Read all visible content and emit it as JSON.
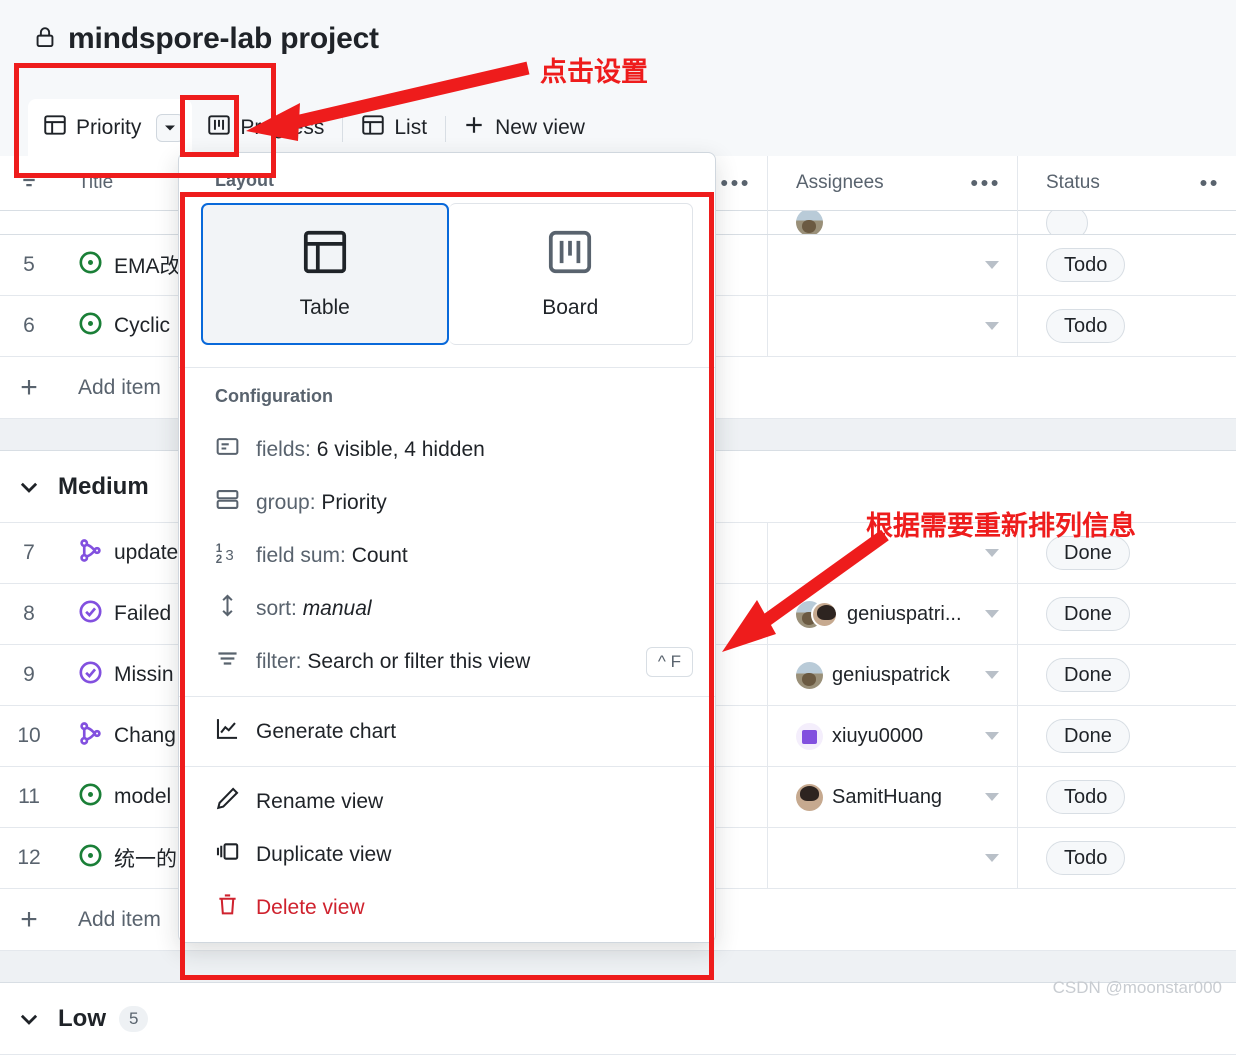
{
  "header": {
    "lock_icon": "lock-icon",
    "title": "mindspore-lab project"
  },
  "tabs": [
    {
      "label": "Priority",
      "icon": "table-view-icon",
      "active": true,
      "caret": "chevron-down-icon"
    },
    {
      "label": "Progress",
      "icon": "board-view-icon",
      "active": false
    },
    {
      "label": "List",
      "icon": "table-view-icon",
      "active": false
    }
  ],
  "new_view": {
    "label": "New view",
    "icon": "plus-icon"
  },
  "table": {
    "columns": [
      {
        "key": "num",
        "label": "",
        "icon": "filter-rows-icon"
      },
      {
        "key": "title",
        "label": "Title",
        "dots": "•••"
      },
      {
        "key": "assignees",
        "label": "Assignees",
        "dots": "•••"
      },
      {
        "key": "status",
        "label": "Status",
        "dots": "••"
      }
    ],
    "rows": [
      {
        "num": "5",
        "icon": "issue-open-icon",
        "icon_color": "#1a7f37",
        "title": "EMA改",
        "assignees": [],
        "status": "Todo"
      },
      {
        "num": "6",
        "icon": "issue-open-icon",
        "icon_color": "#1a7f37",
        "title": "Cyclic",
        "assignees": [],
        "status": "Todo"
      },
      {
        "num": "7",
        "icon": "pull-request-icon",
        "icon_color": "#8250df",
        "title": "update",
        "assignees": [],
        "status": "Done"
      },
      {
        "num": "8",
        "icon": "issue-closed-icon",
        "icon_color": "#8250df",
        "title": "Failed",
        "assignees": [
          "geniuspatri..."
        ],
        "status": "Done"
      },
      {
        "num": "9",
        "icon": "issue-closed-icon",
        "icon_color": "#8250df",
        "title": "Missin",
        "assignees": [
          "geniuspatrick"
        ],
        "status": "Done"
      },
      {
        "num": "10",
        "icon": "pull-request-icon",
        "icon_color": "#8250df",
        "title": "Chang",
        "assignees": [
          "xiuyu0000"
        ],
        "status": "Done"
      },
      {
        "num": "11",
        "icon": "issue-open-icon",
        "icon_color": "#1a7f37",
        "title": "model",
        "assignees": [
          "SamitHuang"
        ],
        "status": "Todo"
      },
      {
        "num": "12",
        "icon": "issue-open-icon",
        "icon_color": "#1a7f37",
        "title": "统一的",
        "assignees": [],
        "status": "Todo"
      }
    ],
    "add_item_label": "Add item",
    "add_item_icon": "plus-icon",
    "groups": [
      {
        "label": "Medium",
        "count": "",
        "chevron": "chevron-down-icon"
      },
      {
        "label": "Low",
        "count": "5",
        "chevron": "chevron-down-icon"
      }
    ]
  },
  "menu": {
    "layout_label": "Layout",
    "layout_options": [
      {
        "label": "Table",
        "icon": "table-layout-icon",
        "selected": true
      },
      {
        "label": "Board",
        "icon": "board-layout-icon",
        "selected": false
      }
    ],
    "configuration_label": "Configuration",
    "items": [
      {
        "name": "fields",
        "text_prefix": "fields: ",
        "text_value": "6 visible, 4 hidden",
        "icon": "fields-icon"
      },
      {
        "name": "group",
        "text_prefix": "group: ",
        "text_value": "Priority",
        "icon": "group-rows-icon"
      },
      {
        "name": "field-sum",
        "text_prefix": "field sum: ",
        "text_value": "Count",
        "icon": "number-sum-icon"
      },
      {
        "name": "sort",
        "text_prefix": "sort: ",
        "text_value": "manual",
        "italic": true,
        "icon": "sort-icon"
      },
      {
        "name": "filter",
        "text_prefix": "filter: ",
        "text_value": "Search or filter this view",
        "icon": "filter-icon",
        "shortcut": "^ F"
      }
    ],
    "generate_chart": {
      "label": "Generate chart",
      "icon": "line-chart-icon"
    },
    "actions": [
      {
        "label": "Rename view",
        "icon": "pencil-icon",
        "danger": false
      },
      {
        "label": "Duplicate view",
        "icon": "duplicate-icon",
        "danger": false
      },
      {
        "label": "Delete view",
        "icon": "trash-icon",
        "danger": true
      }
    ]
  },
  "annotations": {
    "accent_color": "#ee1c1c",
    "callout_1": "点击设置",
    "callout_2": "根据需要重新排列信息"
  },
  "watermark": "CSDN @moonstar000"
}
